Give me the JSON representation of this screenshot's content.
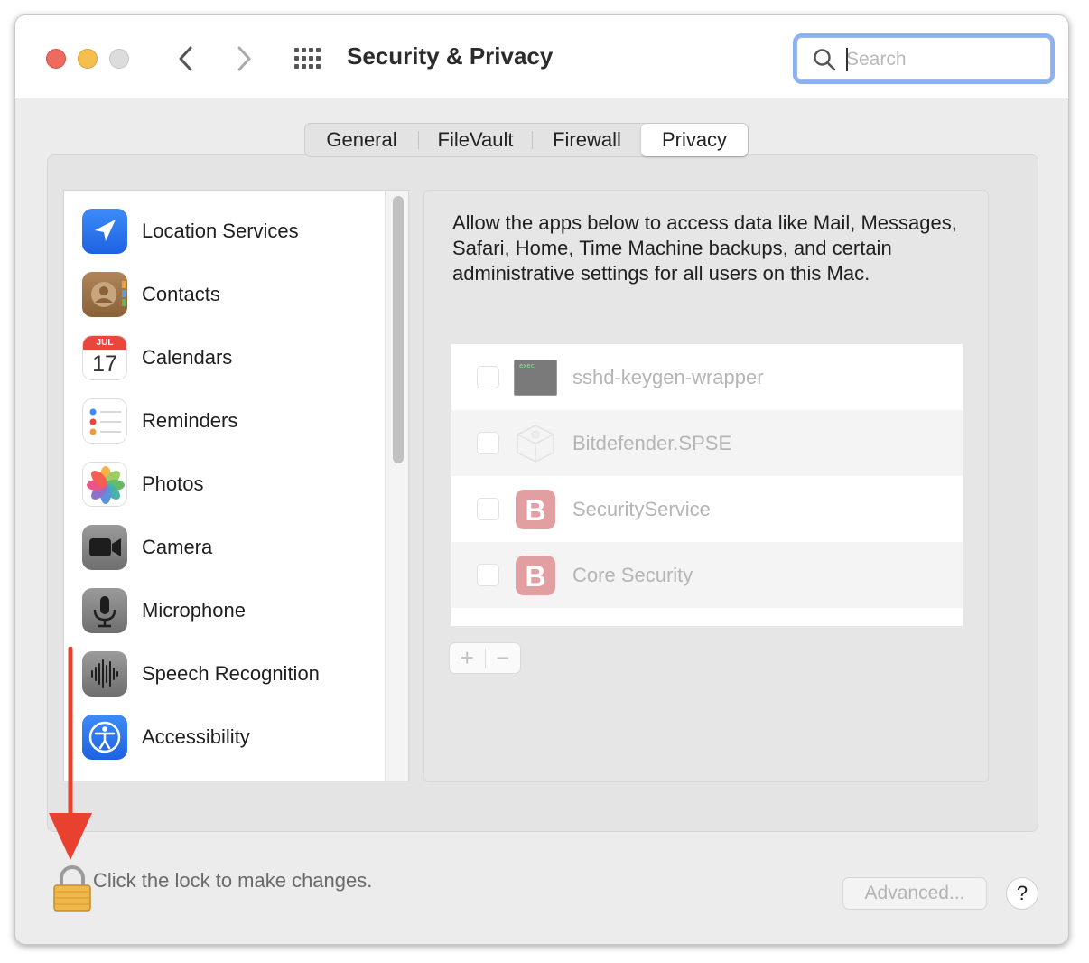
{
  "window": {
    "title": "Security & Privacy",
    "search_placeholder": "Search"
  },
  "tabs": [
    {
      "label": "General"
    },
    {
      "label": "FileVault"
    },
    {
      "label": "Firewall"
    },
    {
      "label": "Privacy"
    }
  ],
  "selected_tab": "Privacy",
  "sidebar": {
    "items": [
      {
        "label": "Location Services",
        "icon": "location-arrow-icon"
      },
      {
        "label": "Contacts",
        "icon": "contacts-icon"
      },
      {
        "label": "Calendars",
        "icon": "calendar-icon",
        "month": "JUL",
        "day": "17"
      },
      {
        "label": "Reminders",
        "icon": "reminders-icon"
      },
      {
        "label": "Photos",
        "icon": "photos-icon"
      },
      {
        "label": "Camera",
        "icon": "camera-icon"
      },
      {
        "label": "Microphone",
        "icon": "microphone-icon"
      },
      {
        "label": "Speech Recognition",
        "icon": "speech-waveform-icon"
      },
      {
        "label": "Accessibility",
        "icon": "accessibility-icon"
      }
    ]
  },
  "detail": {
    "description": "Allow the apps below to access data like Mail, Messages, Safari, Home, Time Machine backups, and certain administrative settings for all users on this Mac.",
    "apps": [
      {
        "name": "sshd-keygen-wrapper",
        "icon": "terminal-exec-icon",
        "checked": false
      },
      {
        "name": "Bitdefender.SPSE",
        "icon": "system-extension-icon",
        "checked": false
      },
      {
        "name": "SecurityService",
        "icon": "bitdefender-b-icon",
        "checked": false
      },
      {
        "name": "Core Security",
        "icon": "bitdefender-b-icon",
        "checked": false
      }
    ],
    "terminal_icon_text": "exec",
    "add_label": "+",
    "remove_label": "−"
  },
  "footer": {
    "lock_text": "Click the lock to make changes.",
    "advanced_label": "Advanced...",
    "help_label": "?"
  },
  "colors": {
    "accent": "#2f7cf6",
    "annotation_arrow": "#e8412f",
    "bitdefender": "#e29fa2"
  }
}
